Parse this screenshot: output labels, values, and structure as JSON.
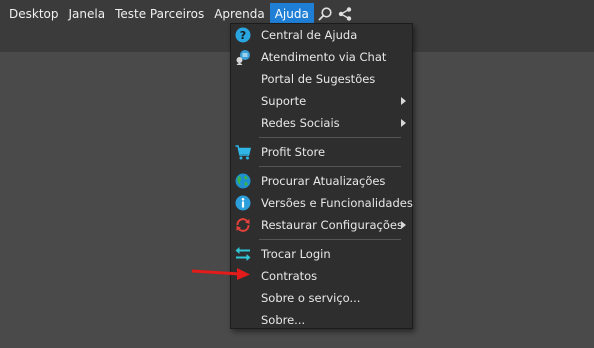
{
  "menubar": {
    "items": [
      "Desktop",
      "Janela",
      "Teste Parceiros",
      "Aprenda",
      "Ajuda"
    ],
    "active": "Ajuda",
    "icons": [
      "search-icon",
      "share-icon"
    ]
  },
  "dropdown": {
    "items": [
      {
        "label": "Central de Ajuda",
        "icon": "help-icon"
      },
      {
        "label": "Atendimento via Chat",
        "icon": "chat-icon"
      },
      {
        "label": "Portal de Sugestões",
        "icon": null
      },
      {
        "label": "Suporte",
        "icon": null,
        "submenu": true
      },
      {
        "label": "Redes Sociais",
        "icon": null,
        "submenu": true
      },
      {
        "label": "Profit Store",
        "icon": "cart-icon"
      },
      {
        "label": "Procurar Atualizações",
        "icon": "globe-icon"
      },
      {
        "label": "Versões e Funcionalidades",
        "icon": "info-icon"
      },
      {
        "label": "Restaurar Configurações",
        "icon": "restore-icon",
        "submenu": true
      },
      {
        "label": "Trocar Login",
        "icon": "swap-icon"
      },
      {
        "label": "Contratos",
        "icon": null
      },
      {
        "label": "Sobre o serviço...",
        "icon": null
      },
      {
        "label": "Sobre...",
        "icon": null
      }
    ]
  },
  "colors": {
    "menubar_bg": "#3b3b3b",
    "active_bg": "#1f7fd6",
    "dropdown_bg": "#2e2e2e",
    "annotation_arrow": "#e31b1b"
  }
}
